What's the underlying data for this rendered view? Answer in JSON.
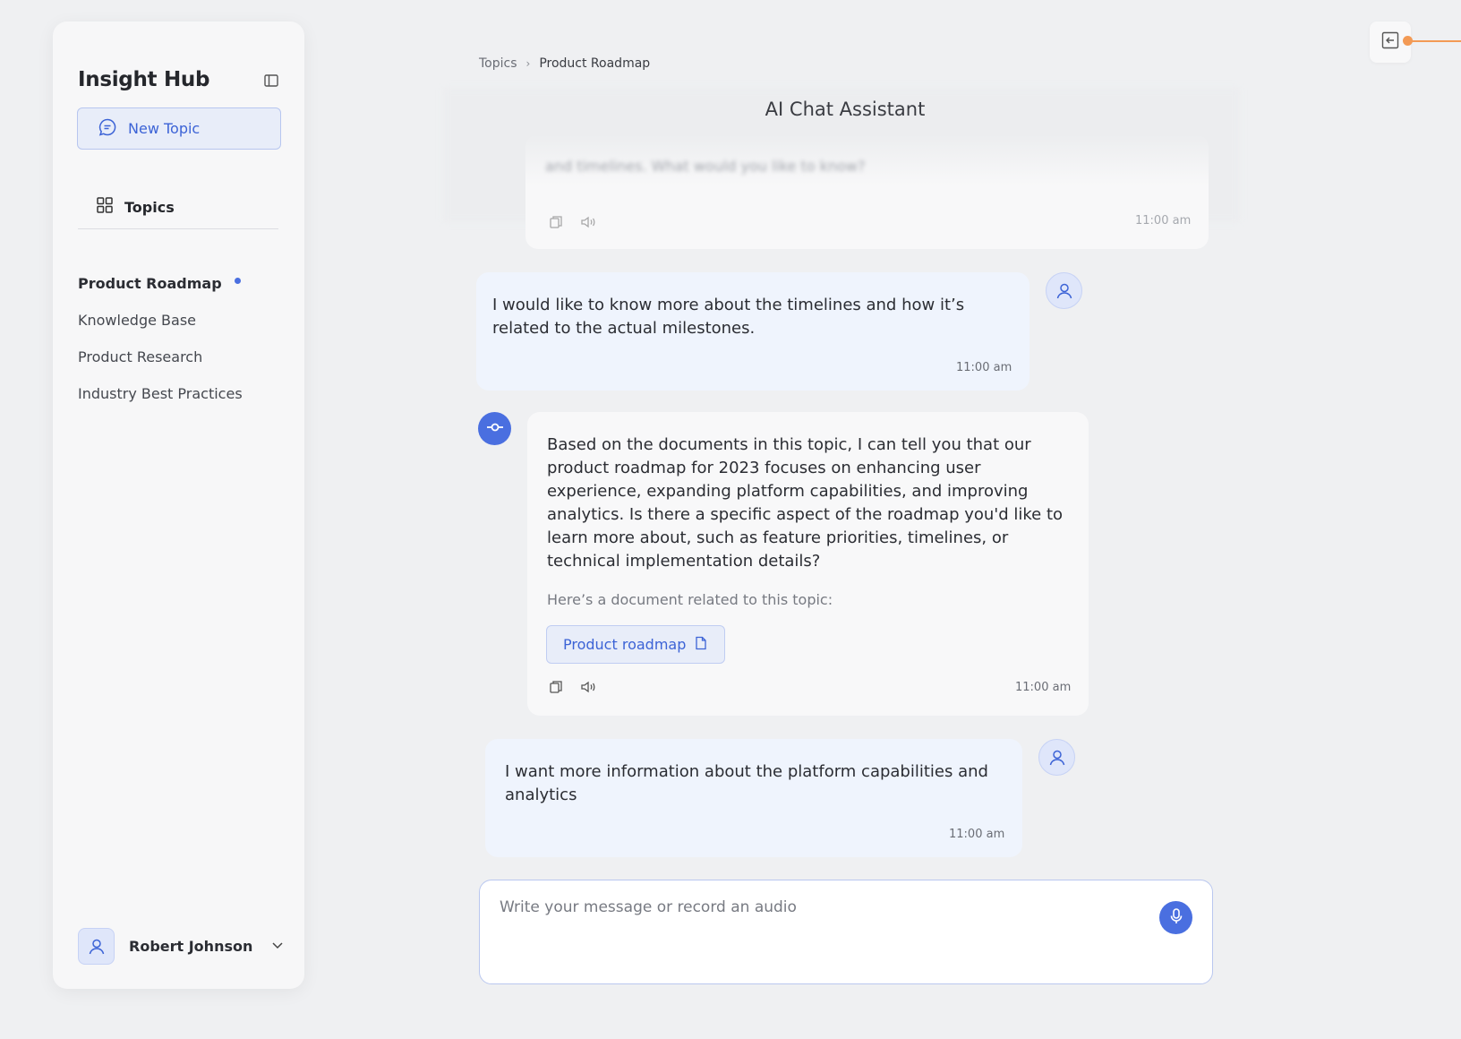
{
  "app": {
    "title": "Insight Hub"
  },
  "sidebar": {
    "new_topic_label": "New Topic",
    "topics_label": "Topics",
    "items": [
      {
        "label": "Product Roadmap",
        "active": true
      },
      {
        "label": "Knowledge Base",
        "active": false
      },
      {
        "label": "Product Research",
        "active": false
      },
      {
        "label": "Industry Best Practices",
        "active": false
      }
    ],
    "user": {
      "name": "Robert Johnson"
    }
  },
  "breadcrumb": {
    "parent": "Topics",
    "separator": "›",
    "current": "Product Roadmap"
  },
  "header": {
    "title": "AI Chat Assistant"
  },
  "messages": {
    "previous": {
      "text": "and timelines. What would you like to know?",
      "time": "11:00 am"
    },
    "user_1": {
      "text": "I  would like to know more about the timelines and how it’s related to the actual milestones.",
      "time": "11:00 am"
    },
    "assistant_1": {
      "text": "Based on the documents in this topic, I can tell you that our product roadmap for 2023 focuses on enhancing user experience, expanding platform capabilities, and improving analytics. Is there a specific aspect of the roadmap you'd like to learn more about, such as feature priorities, timelines, or technical implementation details?",
      "doc_note": "Here’s a document related to this topic:",
      "doc_label": "Product roadmap",
      "time": "11:00 am"
    },
    "user_2": {
      "text": "I want more information about the platform capabilities and analytics",
      "time": "11:00 am"
    }
  },
  "composer": {
    "placeholder": "Write your message or record an audio"
  },
  "colors": {
    "accent": "#4a6fe0",
    "accent_text": "#3c63d6",
    "user_bubble": "#eff4fd",
    "orange": "#f39a55"
  }
}
